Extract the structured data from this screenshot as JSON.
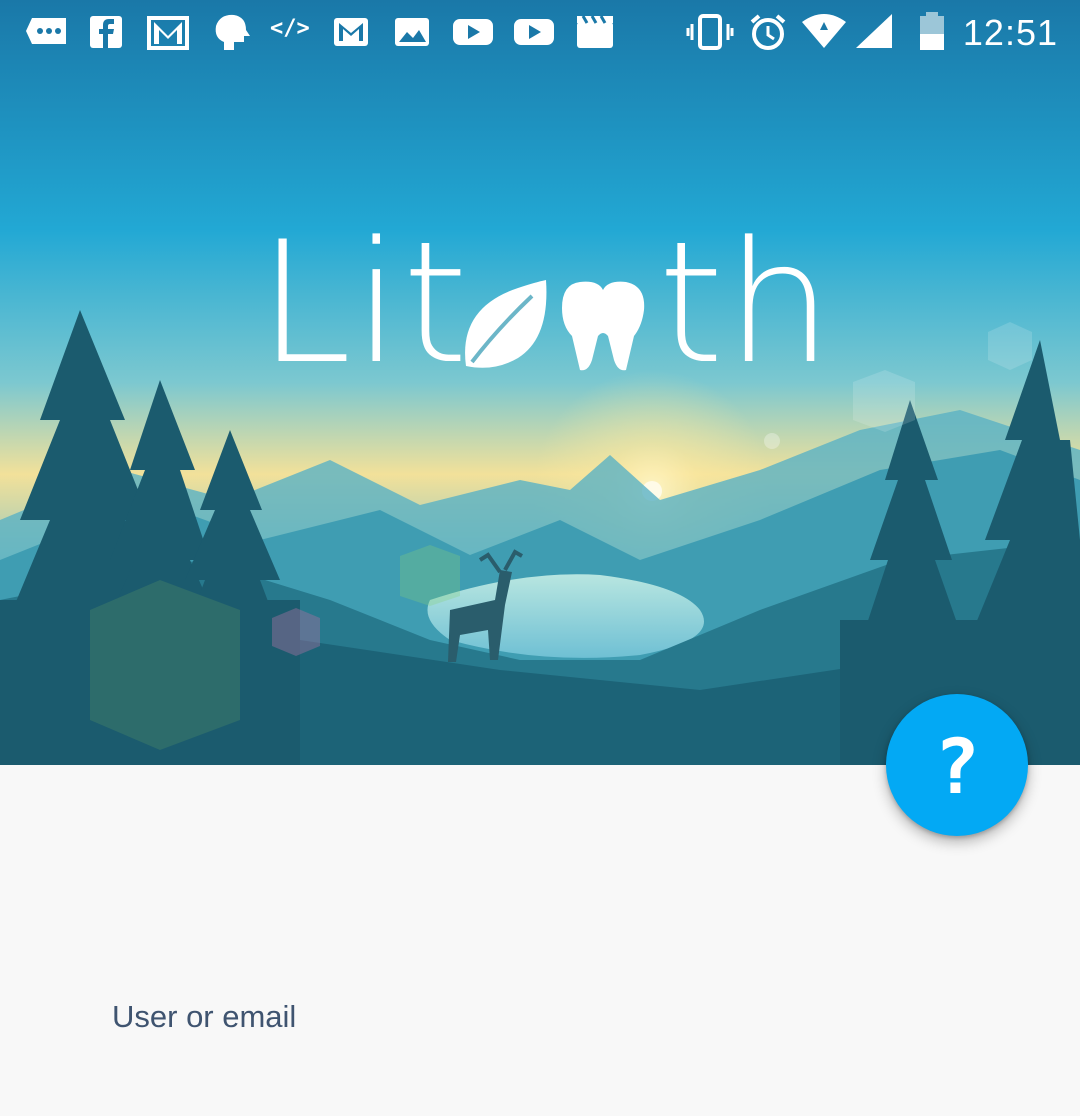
{
  "status_bar": {
    "time": "12:51",
    "left_icons": [
      "messages-icon",
      "facebook-icon",
      "gmail-outline-icon",
      "head-profile-icon",
      "code-icon",
      "gmail-icon",
      "image-icon",
      "youtube-icon",
      "youtube-icon",
      "clapperboard-icon"
    ],
    "right_icons": [
      "vibrate-icon",
      "alarm-icon",
      "wifi-icon",
      "cell-signal-icon",
      "battery-icon"
    ]
  },
  "app": {
    "name": "Litooth",
    "logo_text_left": "Lit",
    "logo_text_right": "th"
  },
  "help_button": {
    "label": "?"
  },
  "login_form": {
    "user_label": "User or email",
    "user_value": ""
  },
  "colors": {
    "accent": "#03a9f4",
    "label_text": "#3f5470",
    "background": "#f8f8f8"
  }
}
